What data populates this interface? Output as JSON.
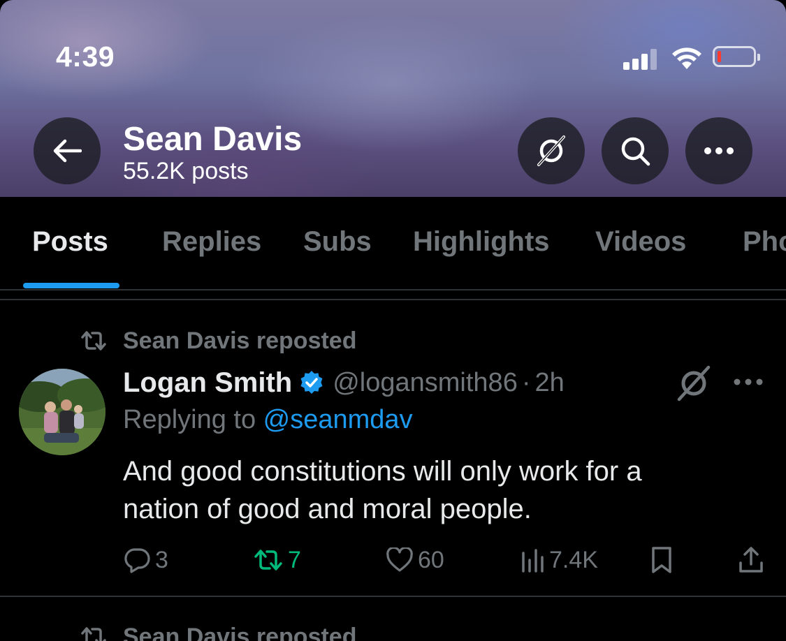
{
  "status_bar": {
    "time": "4:39",
    "icons": [
      "cellular-signal-icon",
      "wifi-icon",
      "battery-low-icon"
    ]
  },
  "header": {
    "profile_name": "Sean Davis",
    "post_count": "55.2K posts",
    "buttons": [
      "back-arrow-icon",
      "grok-icon",
      "search-icon",
      "more-icon"
    ]
  },
  "tabs": {
    "items": [
      {
        "label": "Posts",
        "active": true
      },
      {
        "label": "Replies",
        "active": false
      },
      {
        "label": "Subs",
        "active": false
      },
      {
        "label": "Highlights",
        "active": false
      },
      {
        "label": "Videos",
        "active": false
      },
      {
        "label": "Photos",
        "active": false
      }
    ]
  },
  "posts": [
    {
      "repost_label": "Sean Davis reposted",
      "author_name": "Logan Smith",
      "verified": true,
      "handle": "@logansmith86",
      "separator": "·",
      "time": "2h",
      "replying_prefix": "Replying to ",
      "replying_to": "@seanmdav",
      "text_lines": [
        "And good constitutions will only work for a",
        "nation of good and moral people."
      ],
      "stats": {
        "replies": "3",
        "reposts": "7",
        "likes": "60",
        "views": "7.4K"
      }
    },
    {
      "repost_label": "Sean Davis reposted"
    }
  ],
  "colors": {
    "accent": "#1d9bf0",
    "repost_green": "#00ba7c",
    "muted_text": "#71767b",
    "primary_text": "#e7e9ea",
    "background": "#000000"
  }
}
